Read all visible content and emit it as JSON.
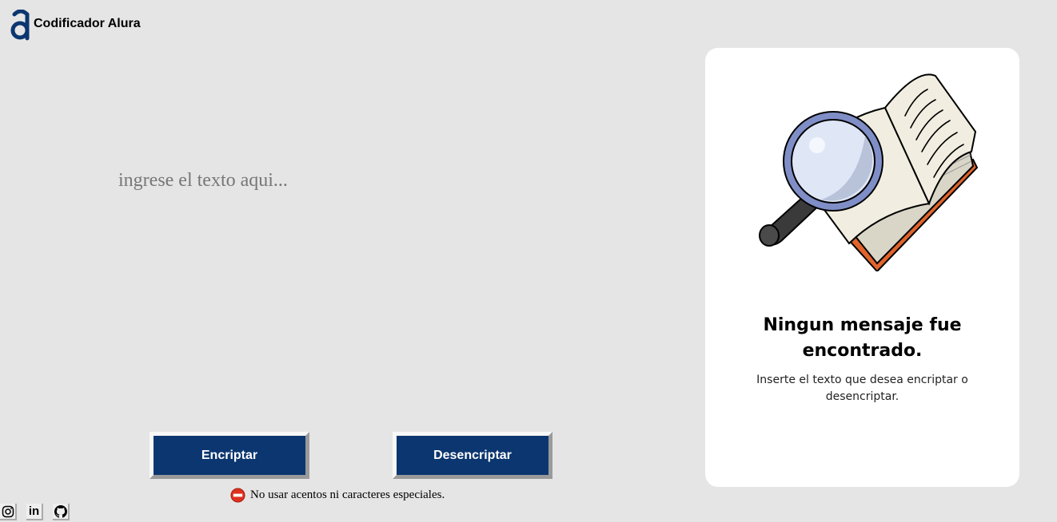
{
  "header": {
    "logo_icon": "alura-logo-icon",
    "title": "Codificador Alura",
    "brand_color": "#0b3670"
  },
  "input": {
    "placeholder": "ingrese el texto aqui...",
    "value": ""
  },
  "buttons": {
    "encrypt_label": "Encriptar",
    "decrypt_label": "Desencriptar",
    "color": "#0b3670"
  },
  "warning": {
    "icon": "no-entry-icon",
    "text": "No usar acentos ni caracteres especiales."
  },
  "socials": [
    {
      "name": "instagram",
      "icon": "instagram-icon"
    },
    {
      "name": "linkedin",
      "icon": "linkedin-icon",
      "label": "in"
    },
    {
      "name": "github",
      "icon": "github-icon"
    }
  ],
  "output_card": {
    "illustration": "book-magnifier-illustration",
    "title": "Ningun mensaje fue encontrado.",
    "subtitle": "Inserte el texto que desea encriptar o desencriptar."
  }
}
